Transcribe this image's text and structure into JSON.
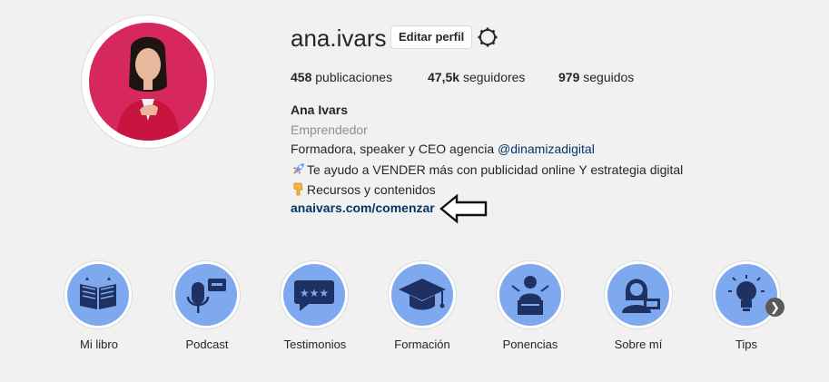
{
  "profile": {
    "username": "ana.ivars",
    "edit_label": "Editar perfil",
    "settings_icon": "gear-icon"
  },
  "stats": {
    "posts_count": "458",
    "posts_label": "publicaciones",
    "followers_count": "47,5k",
    "followers_label": "seguidores",
    "following_count": "979",
    "following_label": "seguidos"
  },
  "bio": {
    "name": "Ana Ivars",
    "category": "Emprendedor",
    "line1_prefix": "Formadora, speaker y CEO agencia ",
    "line1_mention": "@dinamizadigital",
    "line2_icon": "rocket-emoji",
    "line2_text": "Te ayudo a VENDER más con publicidad online Y estrategia digital",
    "line3_icon": "pointing-down-emoji",
    "line3_text": "Recursos y contenidos",
    "link": "anaivars.com/comenzar"
  },
  "highlights": [
    {
      "label": "Mi libro",
      "icon": "book-icon"
    },
    {
      "label": "Podcast",
      "icon": "microphone-icon"
    },
    {
      "label": "Testimonios",
      "icon": "chat-stars-icon"
    },
    {
      "label": "Formación",
      "icon": "graduation-cap-icon"
    },
    {
      "label": "Ponencias",
      "icon": "speaker-podium-icon"
    },
    {
      "label": "Sobre mí",
      "icon": "woman-laptop-icon"
    },
    {
      "label": "Tips",
      "icon": "lightbulb-icon"
    }
  ],
  "colors": {
    "highlight_bg": "#7fa9ee",
    "link": "#00376b",
    "avatar_bg": "#d7285e"
  }
}
